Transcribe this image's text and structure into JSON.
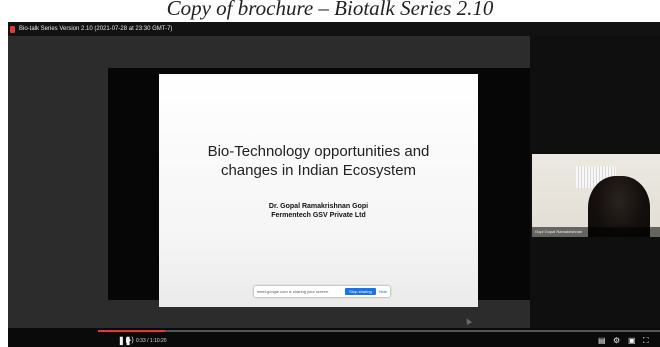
{
  "caption": "Copy of brochure – Biotalk Series 2.10",
  "window": {
    "title": "Bio-talk Series Version 2.10 (2021-07-28 at 23:30 GMT-7)"
  },
  "slide": {
    "title_line1": "Bio-Technology opportunities and",
    "title_line2": "changes in Indian Ecosystem",
    "author_line1": "Dr. Gopal Ramakrishnan Gopi",
    "author_line2": "Fermentech GSV Private Ltd"
  },
  "share_bar": {
    "text": "meet.google.com is sharing your screen.",
    "stop_label": "Stop sharing",
    "hide_label": "Hide"
  },
  "webcam": {
    "participant_name": "Gopi Gopal Ramakrishnan"
  },
  "player": {
    "time": "0:33 / 1:10:20",
    "progress_fraction": 0.12
  },
  "colors": {
    "accent_red": "#e53935",
    "share_blue": "#1a73e8"
  },
  "icons": [
    "record-icon",
    "play-pause-icon",
    "volume-icon",
    "captions-icon",
    "settings-icon",
    "miniplayer-icon",
    "fullscreen-icon",
    "cursor-icon"
  ]
}
